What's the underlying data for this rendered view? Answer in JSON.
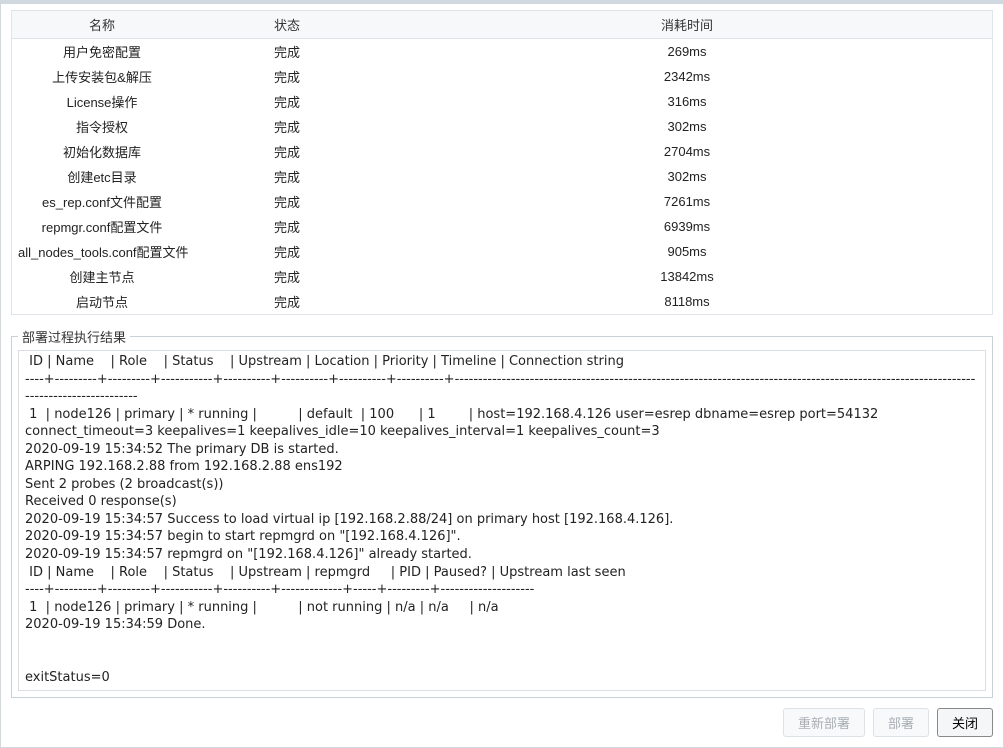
{
  "table": {
    "headers": {
      "name": "名称",
      "state": "状态",
      "time": "消耗时间"
    },
    "rows": [
      {
        "name": "用户免密配置",
        "state": "完成",
        "time": "269ms"
      },
      {
        "name": "上传安装包&解压",
        "state": "完成",
        "time": "2342ms"
      },
      {
        "name": "License操作",
        "state": "完成",
        "time": "316ms"
      },
      {
        "name": "指令授权",
        "state": "完成",
        "time": "302ms"
      },
      {
        "name": "初始化数据库",
        "state": "完成",
        "time": "2704ms"
      },
      {
        "name": "创建etc目录",
        "state": "完成",
        "time": "302ms"
      },
      {
        "name": "es_rep.conf文件配置",
        "state": "完成",
        "time": "7261ms"
      },
      {
        "name": "repmgr.conf配置文件",
        "state": "完成",
        "time": "6939ms"
      },
      {
        "name": "all_nodes_tools.conf配置文件",
        "state": "完成",
        "time": "905ms"
      },
      {
        "name": "创建主节点",
        "state": "完成",
        "time": "13842ms"
      },
      {
        "name": "启动节点",
        "state": "完成",
        "time": "8118ms"
      }
    ]
  },
  "result": {
    "legend": "部署过程执行结果",
    "log": " ID | Name    | Role    | Status    | Upstream | Location | Priority | Timeline | Connection string                                                                                                                    \n----+---------+---------+-----------+----------+----------+----------+----------+---------------------------------------------------------------------------------------------------------------------------------------\n 1  | node126 | primary | * running |          | default  | 100      | 1        | host=192.168.4.126 user=esrep dbname=esrep port=54132 connect_timeout=3 keepalives=1 keepalives_idle=10 keepalives_interval=1 keepalives_count=3\n2020-09-19 15:34:52 The primary DB is started.\nARPING 192.168.2.88 from 192.168.2.88 ens192\nSent 2 probes (2 broadcast(s))\nReceived 0 response(s)\n2020-09-19 15:34:57 Success to load virtual ip [192.168.2.88/24] on primary host [192.168.4.126].\n2020-09-19 15:34:57 begin to start repmgrd on \"[192.168.4.126]\".\n2020-09-19 15:34:57 repmgrd on \"[192.168.4.126]\" already started.\n ID | Name    | Role    | Status    | Upstream | repmgrd     | PID | Paused? | Upstream last seen\n----+---------+---------+-----------+----------+-------------+-----+---------+--------------------\n 1  | node126 | primary | * running |          | not running | n/a | n/a     | n/a                \n2020-09-19 15:34:59 Done.\n\n\nexitStatus=0"
  },
  "buttons": {
    "redeploy": "重新部署",
    "deploy": "部署",
    "close": "关闭"
  }
}
